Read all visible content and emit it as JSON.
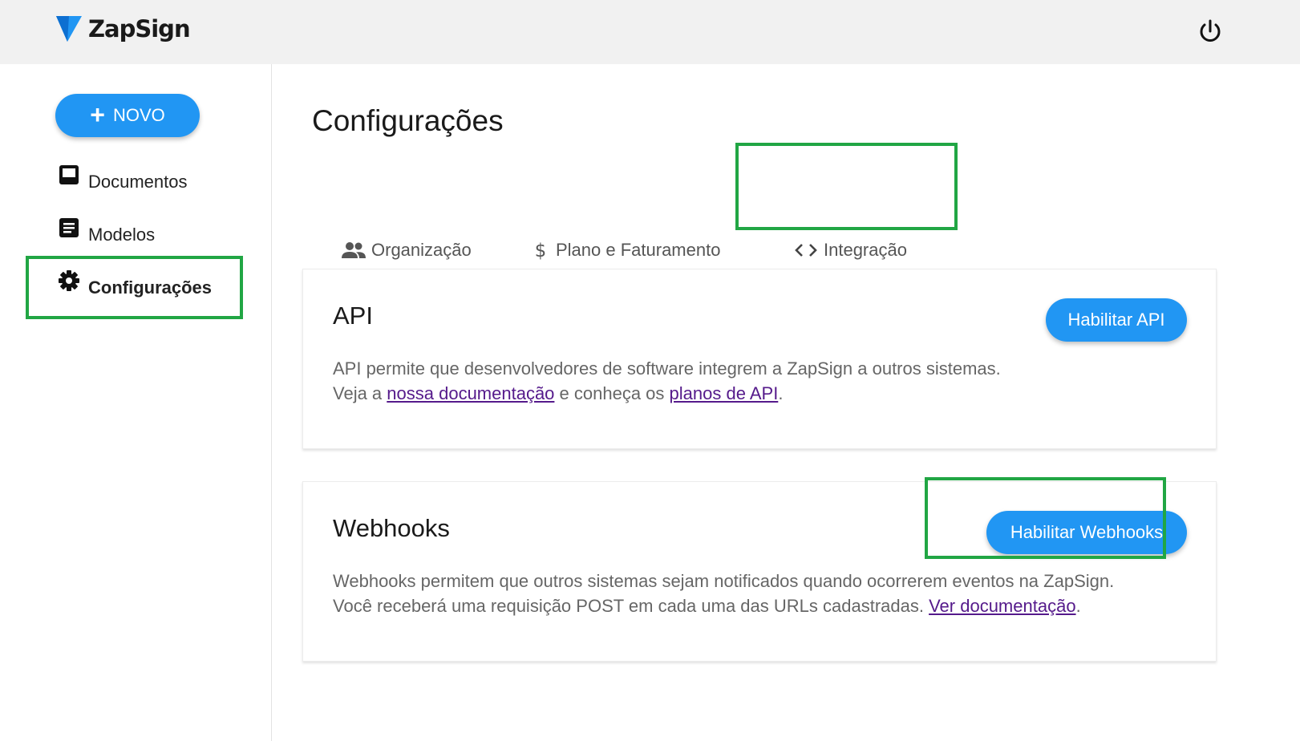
{
  "app": {
    "logo_text": "ZapSign"
  },
  "sidebar": {
    "new_button_plus": "+",
    "new_button_label": "NOVO",
    "items": [
      {
        "label": "Documentos",
        "icon": "inbox-icon"
      },
      {
        "label": "Modelos",
        "icon": "document-icon"
      },
      {
        "label": "Configurações",
        "icon": "gear-icon"
      }
    ]
  },
  "main": {
    "page_title": "Configurações",
    "tabs": [
      {
        "label": "Organização",
        "icon": "people-icon"
      },
      {
        "label": "Plano e Faturamento",
        "icon": "dollar-icon"
      },
      {
        "label": "Integração",
        "icon": "code-icon"
      }
    ],
    "active_tab": "Integração"
  },
  "api_card": {
    "title": "API",
    "line1": "API permite que desenvolvedores de software integrem a ZapSign a outros sistemas.",
    "line2_prefix": "Veja a ",
    "link1": "nossa documentação",
    "line2_middle": " e conheça os ",
    "link2": "planos de API",
    "line2_suffix": ".",
    "button": "Habilitar API"
  },
  "webhooks_card": {
    "title": "Webhooks",
    "line1": "Webhooks permitem que outros sistemas sejam notificados quando ocorrerem eventos na ZapSign.",
    "line2_prefix": "Você receberá uma requisição POST em cada uma das URLs cadastradas. ",
    "link": "Ver documentação",
    "line2_suffix": ".",
    "button": "Habilitar Webhooks"
  },
  "colors": {
    "accent": "#2196f3",
    "highlight_box": "#21a644",
    "link": "#551a8b",
    "topbar": "#f1f1f1"
  }
}
